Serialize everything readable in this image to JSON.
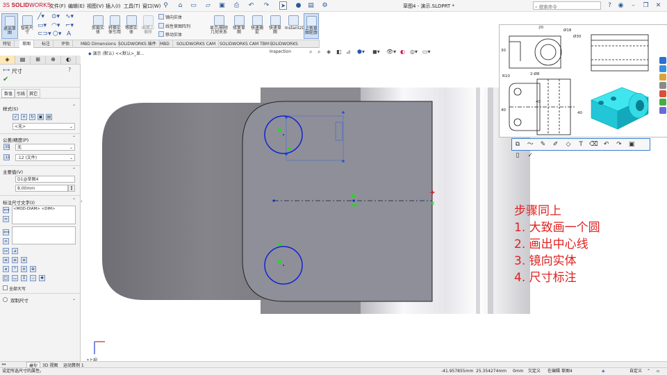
{
  "app": {
    "logo_prefix": "3S",
    "logo_bold": "SOLID",
    "logo_rest": "WORKS",
    "menus": [
      "文件(F)",
      "编辑(E)",
      "视图(V)",
      "插入(I)",
      "工具(T)",
      "窗口(W)"
    ],
    "doc_title": "草图4 - 演示.SLDPRT *",
    "search_placeholder": "搜索命令"
  },
  "ribbon": {
    "buttons": [
      {
        "label": "退出草图"
      },
      {
        "label": "智能尺寸"
      },
      {
        "label": "剪裁实体"
      },
      {
        "label": "转换实体引用"
      },
      {
        "label": "等距实体"
      },
      {
        "label": "曲面上偏移"
      }
    ],
    "mirror_row": "镜向实体",
    "pattern_row": "线性草图阵列",
    "move_row": "移动实体",
    "right_buttons": [
      {
        "label": "显示/删除几何关系"
      },
      {
        "label": "修复草图"
      },
      {
        "label": "快速捕捉"
      },
      {
        "label": "快速草图"
      },
      {
        "label": "Instant2D"
      },
      {
        "label": "上色草图轮廓"
      }
    ]
  },
  "tabs": [
    "特征",
    "草图",
    "标注",
    "评估",
    "MBD Dimensions",
    "SOLIDWORKS 插件",
    "MBD",
    "SOLIDWORKS CAM",
    "SOLIDWORKS CAM TBM",
    "SOLIDWORKS Inspection"
  ],
  "active_tab": "草图",
  "breadcrumb": "演示 (默认) <<默认>_显...",
  "panel": {
    "title": "尺寸",
    "subtabs": [
      "数值",
      "引线",
      "其它"
    ],
    "style_label": "样式(S)",
    "style_value": "<无>",
    "tolerance_label": "公差/精度(P)",
    "tolerance_value": "无",
    "precision_value": ".12 (文件)",
    "primary_label": "主要值(V)",
    "dim_name": "D1@草图4",
    "dim_value": "8.00mm",
    "text_label": "标注尺寸文字(I)",
    "text_value": "<MOD-DIAM> <DIM>",
    "symbols": [
      "⌀",
      "°",
      "±",
      "⊕"
    ],
    "all_caps": "全部大写",
    "dual_dim": "双制尺寸"
  },
  "viewport": {
    "orientation_label": "*上视",
    "steps": [
      "步骤同上",
      "1. 大致画一个圆",
      "2. 画出中心线",
      "3. 镜向实体",
      "4. 尺寸标注"
    ]
  },
  "drawing": {
    "dims": [
      "20",
      "Ø18",
      "Ø30",
      "R10",
      "2-Ø8",
      "40",
      "40",
      "40",
      "30"
    ]
  },
  "bottom_tabs": [
    "模型",
    "3D 视图",
    "运动算例 1"
  ],
  "status": {
    "hint": "设定所选尺寸的属性。",
    "x": "-41.957855mm",
    "y": "25.354274mm",
    "z": "0mm",
    "state": "欠定义",
    "editing": "在编辑 草图4",
    "units": "自定义"
  },
  "colors": {
    "accent": "#1e56c8",
    "steps": "#e0201f",
    "sketch_circle": "#1024d0",
    "part_face": "#8e8e98"
  }
}
